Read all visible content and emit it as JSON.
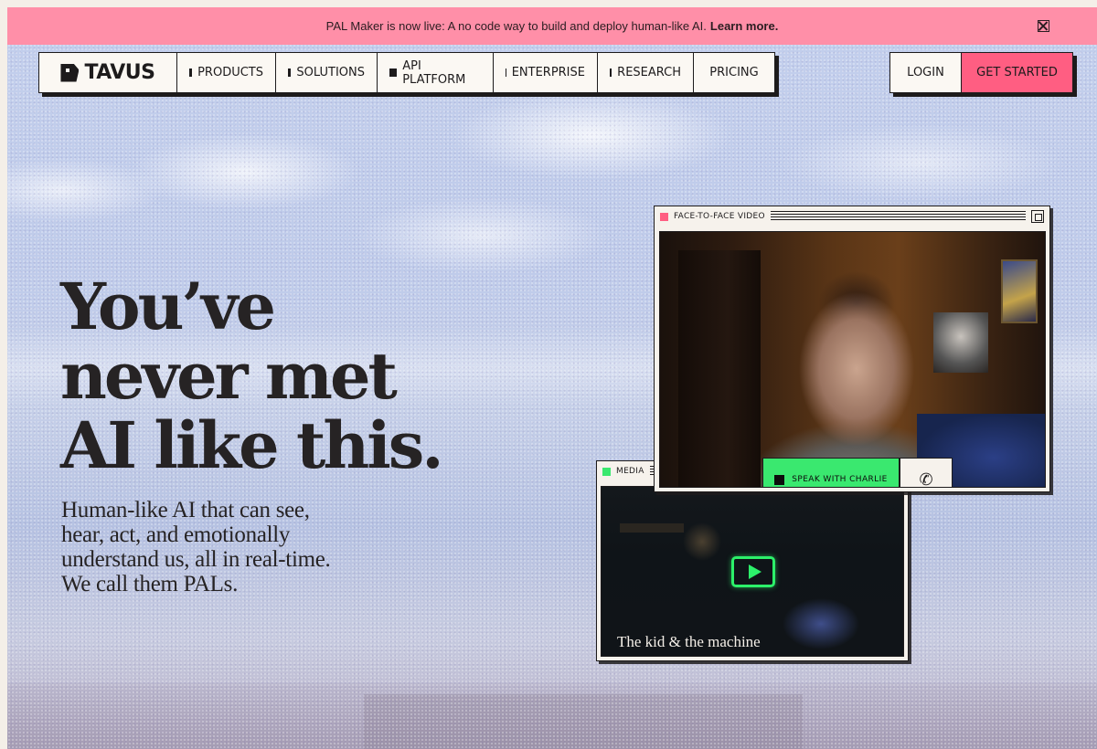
{
  "banner": {
    "text": "PAL Maker is now live: A no code way to build and deploy human-like AI.",
    "link": "Learn more.",
    "close_icon": "close-icon"
  },
  "nav": {
    "logo": "TAVUS",
    "items": [
      {
        "label": "PRODUCTS"
      },
      {
        "label": "SOLUTIONS"
      },
      {
        "label": "API PLATFORM"
      },
      {
        "label": "ENTERPRISE"
      },
      {
        "label": "RESEARCH"
      },
      {
        "label": "PRICING"
      }
    ],
    "login": "LOGIN",
    "get_started": "GET STARTED"
  },
  "hero": {
    "title_lines": [
      "You’ve",
      "never met",
      "AI like this."
    ],
    "subtitle": "Human-like AI that can see, hear, act, and emotionally understand us, all in real-time. We call them PALs."
  },
  "video_window": {
    "label": "FACE-TO-FACE VIDEO",
    "speak_label": "SPEAK WITH CHARLIE",
    "call_icon": "phone-icon"
  },
  "media_window": {
    "label": "MEDIA",
    "caption": "The kid & the machine",
    "play_icon": "play-icon"
  },
  "colors": {
    "banner": "#ff8fa8",
    "accent": "#ff5e82",
    "green": "#3ae86f"
  }
}
